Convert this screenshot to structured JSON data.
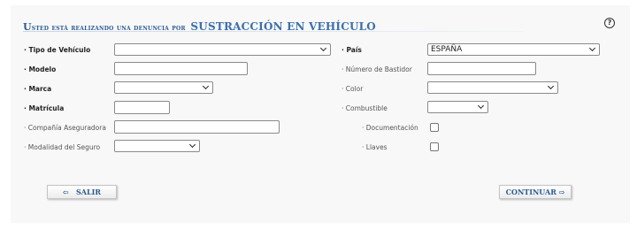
{
  "header": {
    "title_prefix": "Usted está realizando una denuncia por",
    "title_main": "SUSTRACCIÓN EN VEHÍCULO",
    "help_icon": "help-icon",
    "help_glyph": "?"
  },
  "form": {
    "tipo_vehiculo": {
      "label": "· Tipo de Vehículo",
      "value": ""
    },
    "pais": {
      "label": "· País",
      "value": "ESPAÑA"
    },
    "modelo": {
      "label": "· Modelo",
      "value": ""
    },
    "numero_bastidor": {
      "label": "· Número de Bastidor",
      "value": ""
    },
    "marca": {
      "label": "· Marca",
      "value": ""
    },
    "color": {
      "label": "· Color",
      "value": ""
    },
    "matricula": {
      "label": "· Matrícula",
      "value": ""
    },
    "combustible": {
      "label": "· Combustible",
      "value": ""
    },
    "compania_aseguradora": {
      "label": "· Compañía Aseguradora",
      "value": ""
    },
    "documentacion": {
      "label": "· Documentación",
      "checked": false
    },
    "modalidad_seguro": {
      "label": "· Modalidad del Seguro",
      "value": ""
    },
    "llaves": {
      "label": "· Llaves",
      "checked": false
    }
  },
  "buttons": {
    "salir": {
      "label": "SALIR",
      "arrow": "⇦"
    },
    "continuar": {
      "label": "CONTINUAR",
      "arrow": "⇨"
    }
  }
}
